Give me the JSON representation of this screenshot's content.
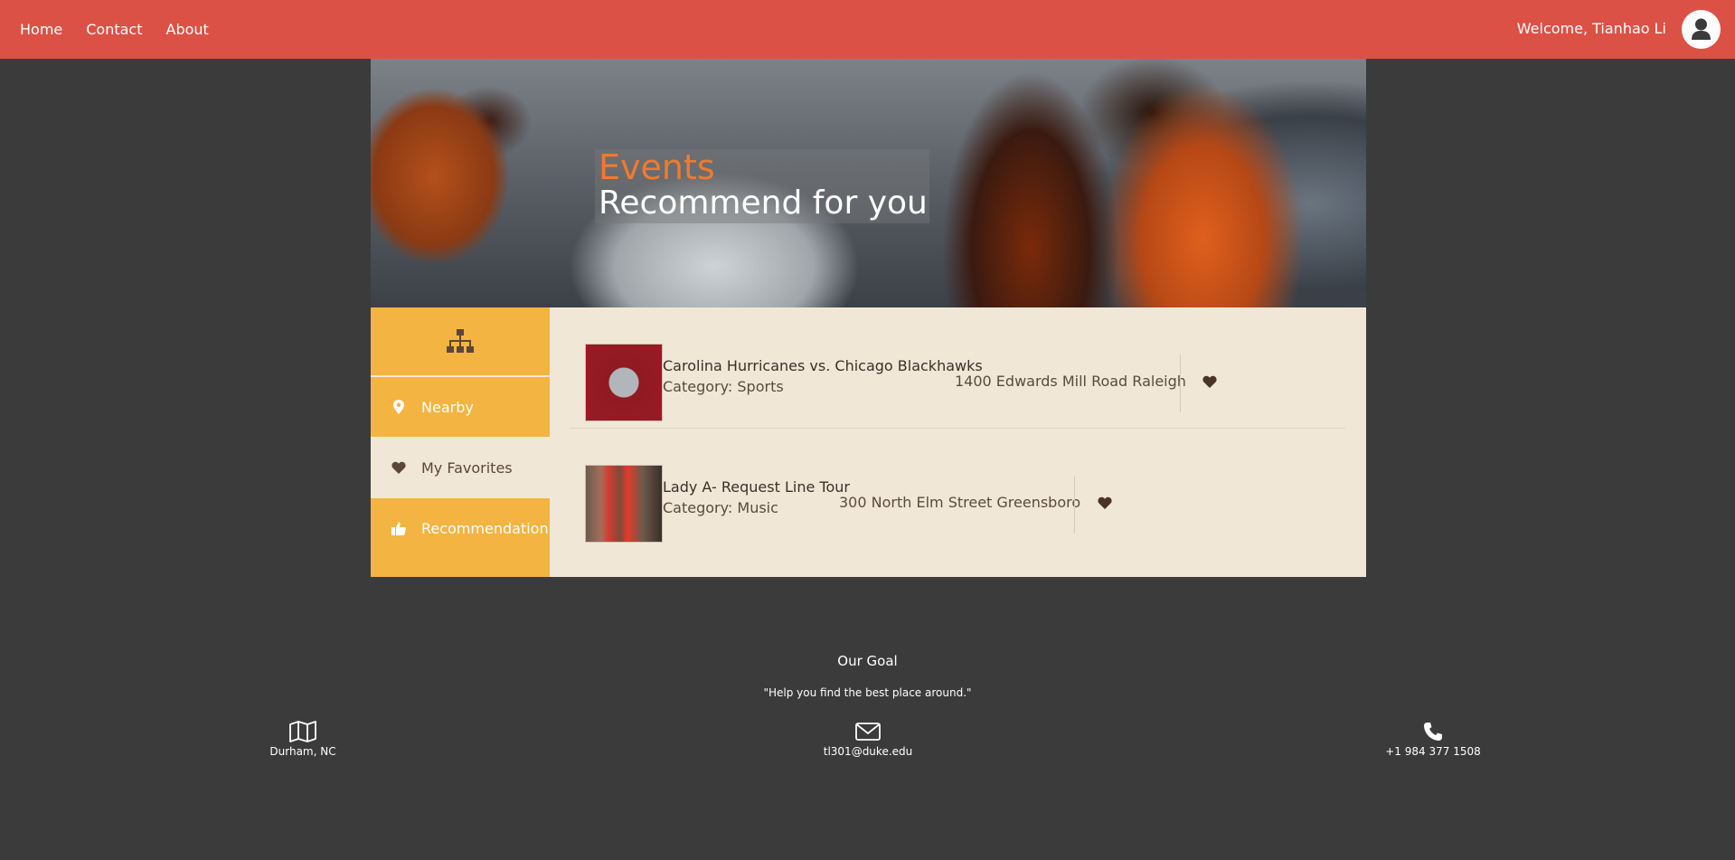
{
  "nav": {
    "home": "Home",
    "contact": "Contact",
    "about": "About"
  },
  "user": {
    "welcome": "Welcome, Tianhao Li",
    "avatar_icon": "user-icon"
  },
  "banner": {
    "title": "Events",
    "subtitle": "Recommend for you"
  },
  "sidebar": {
    "head_icon": "sitemap-icon",
    "items": [
      {
        "label": "Nearby",
        "icon": "map-marker-icon",
        "active": false
      },
      {
        "label": "My Favorites",
        "icon": "heart-icon",
        "active": true
      },
      {
        "label": "Recommendation",
        "icon": "thumbs-up-icon",
        "active": false
      }
    ]
  },
  "events": [
    {
      "name": "Carolina Hurricanes vs. Chicago Blackhawks",
      "category": "Category: Sports",
      "address": "1400 Edwards Mill Road Raleigh",
      "favorite_icon": "heart-icon"
    },
    {
      "name": "Lady A- Request Line Tour",
      "category": "Category: Music",
      "address": "300 North Elm Street Greensboro",
      "favorite_icon": "heart-icon"
    }
  ],
  "footer": {
    "title": "Our Goal",
    "quote": "\"Help you find the best place around.\"",
    "location": "Durham, NC",
    "email": "tl301@duke.edu",
    "phone": "+1 984 377 1508"
  },
  "colors": {
    "header": "#dc5146",
    "sidebar": "#f3b442",
    "content_bg": "#f1e7d7",
    "page_bg": "#3b3b3b",
    "accent_title": "#f07a2e"
  }
}
